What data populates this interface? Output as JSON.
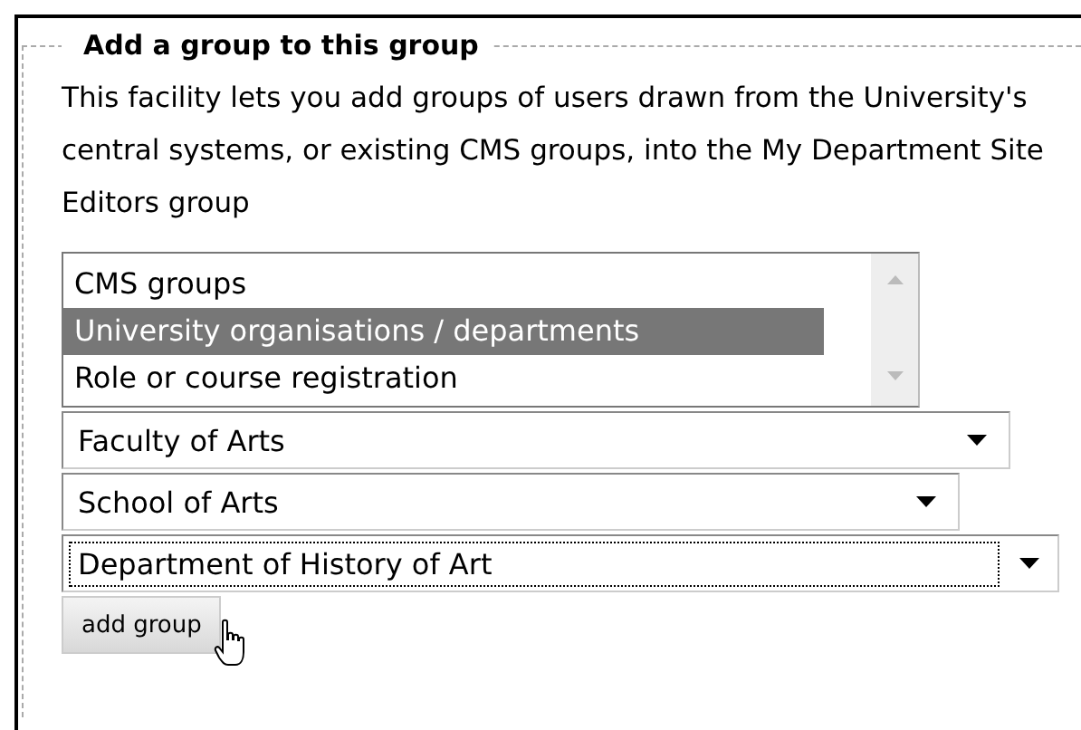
{
  "fieldset": {
    "legend": "Add a group to this group",
    "description": "This facility lets you add groups of users drawn from the University's central systems, or existing CMS groups, into the My Department Site Editors group"
  },
  "source_list": {
    "items": [
      {
        "label": "CMS groups",
        "selected": false
      },
      {
        "label": "University organisations / departments",
        "selected": true
      },
      {
        "label": "Role or course registration",
        "selected": false
      }
    ]
  },
  "dropdowns": [
    {
      "value": "Faculty of Arts",
      "focused": false
    },
    {
      "value": "School of Arts",
      "focused": false
    },
    {
      "value": "Department of History of Art",
      "focused": true
    }
  ],
  "button": {
    "label": "add group"
  }
}
